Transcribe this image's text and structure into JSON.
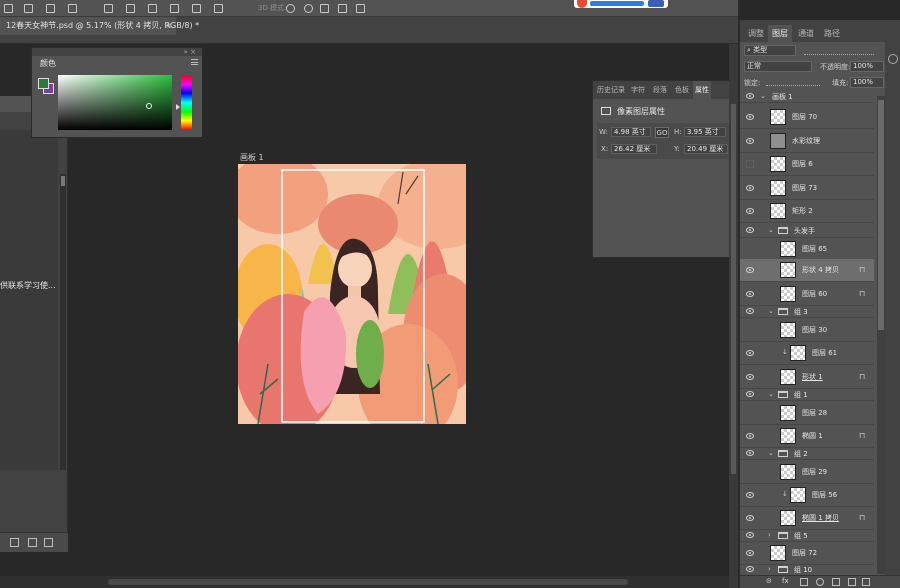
{
  "options_bar": {
    "mode_3d_label": "3D 模式:"
  },
  "document_tab": {
    "title": "12春天女神节.psd @ 5.17% (形状 4 拷贝, RGB/8) *",
    "close": "×"
  },
  "left_panel": {
    "text": "供联系学习使..."
  },
  "color_panel": {
    "tab_label": "颜色",
    "collapse_glyph": "»",
    "close_glyph": "×",
    "foreground_color": "#2a7a3f",
    "background_color": "#7b3fa1"
  },
  "artboard": {
    "label": "画板 1"
  },
  "properties_panel": {
    "tabs": [
      "历史记录",
      "字符",
      "段落",
      "色板",
      "属性"
    ],
    "active_tab": "属性",
    "section_title": "像素图层属性",
    "width_label": "W:",
    "width_value": "4.98 英寸",
    "link_glyph": "GO",
    "height_label": "H:",
    "height_value": "3.95 英寸",
    "x_label": "X:",
    "x_value": "26.42 厘米",
    "y_label": "Y:",
    "y_value": "20.49 厘米"
  },
  "layers_panel": {
    "tabs": [
      "调整",
      "图层",
      "通道",
      "路径"
    ],
    "active_tab": "图层",
    "filter_kind": "类型",
    "blend_mode": "正常",
    "opacity_label": "不透明度:",
    "opacity_value": "100%",
    "lock_label": "锁定:",
    "fill_label": "填充:",
    "fill_value": "100%",
    "layers": [
      {
        "name": "画板 1",
        "kind": "artboard"
      },
      {
        "name": "图层 70",
        "kind": "layer"
      },
      {
        "name": "水彩纹理",
        "kind": "layer"
      },
      {
        "name": "图层 6",
        "kind": "layer"
      },
      {
        "name": "图层 73",
        "kind": "layer"
      },
      {
        "name": "矩形 2",
        "kind": "shape"
      },
      {
        "name": "头发手",
        "kind": "group"
      },
      {
        "name": "图层 65",
        "kind": "layer"
      },
      {
        "name": "形状 4 拷贝",
        "kind": "layer",
        "selected": true
      },
      {
        "name": "图层 60",
        "kind": "layer"
      },
      {
        "name": "组 3",
        "kind": "group"
      },
      {
        "name": "图层 30",
        "kind": "layer"
      },
      {
        "name": "图层 61",
        "kind": "layer"
      },
      {
        "name": "形状 1",
        "kind": "layer"
      },
      {
        "name": "组 1",
        "kind": "group"
      },
      {
        "name": "图层 28",
        "kind": "layer"
      },
      {
        "name": "椭圆 1",
        "kind": "layer"
      },
      {
        "name": "组 2",
        "kind": "group"
      },
      {
        "name": "图层 29",
        "kind": "layer"
      },
      {
        "name": "图层 56",
        "kind": "layer"
      },
      {
        "name": "椭圆 1 拷贝",
        "kind": "layer"
      },
      {
        "name": "组 5",
        "kind": "group"
      },
      {
        "name": "图层 72",
        "kind": "layer"
      },
      {
        "name": "组 10",
        "kind": "group"
      }
    ],
    "footer_fx": "fx"
  }
}
